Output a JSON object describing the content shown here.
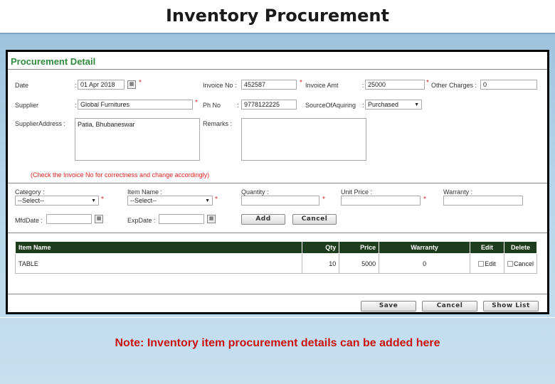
{
  "slide": {
    "title": "Inventory Procurement",
    "note": "Note: Inventory item procurement details can be added here"
  },
  "form": {
    "panel_title": "Procurement Detail",
    "date_label": "Date",
    "date_value": "01 Apr 2018",
    "invoice_no_label": "Invoice No :",
    "invoice_no_value": "452587",
    "invoice_amt_label": "Invoice Amt",
    "invoice_amt_value": "25000",
    "other_charges_label": "Other Charges :",
    "other_charges_value": "0",
    "supplier_label": "Supplier",
    "supplier_value": "Global Furnitures",
    "ph_no_label": "Ph No",
    "ph_no_value": "9778122225",
    "source_label": "SourceOfAquiring",
    "source_value": "Purchased",
    "supplier_address_label": "SupplierAddress :",
    "supplier_address_value": "Patia, Bhubaneswar",
    "remarks_label": "Remarks :",
    "remarks_value": "",
    "invoice_check_note": "(Check the Invoice No for correctness and change accordingly)"
  },
  "item": {
    "category_label": "Category :",
    "category_value": "--Select--",
    "item_name_label": "Item Name :",
    "item_name_value": "--Select--",
    "quantity_label": "Quantity :",
    "quantity_value": "",
    "unit_price_label": "Unit Price :",
    "unit_price_value": "",
    "warranty_label": "Warranty :",
    "warranty_value": "",
    "mfd_label": "MfdDate :",
    "mfd_value": "",
    "exp_label": "ExpDate :",
    "exp_value": "",
    "add_label": "Add",
    "cancel_label": "Cancel"
  },
  "table": {
    "headers": [
      "Item Name",
      "Qty",
      "Price",
      "Warranty",
      "Edit",
      "Delete"
    ],
    "rows": [
      {
        "item_name": "TABLE",
        "qty": "10",
        "price": "5000",
        "warranty": "0",
        "edit": "Edit",
        "delete": "Cancel"
      }
    ]
  },
  "footer": {
    "save_label": "Save",
    "cancel_label": "Cancel",
    "show_list_label": "Show List"
  },
  "colors": {
    "title_green": "#2f8a3e",
    "table_header": "#1e3d1e",
    "note_red": "#cc1111",
    "required_red": "#dd2222"
  },
  "icons": {
    "calendar": "calendar-icon",
    "dropdown": "chevron-down-icon",
    "edit": "edit-icon",
    "delete": "delete-icon"
  }
}
